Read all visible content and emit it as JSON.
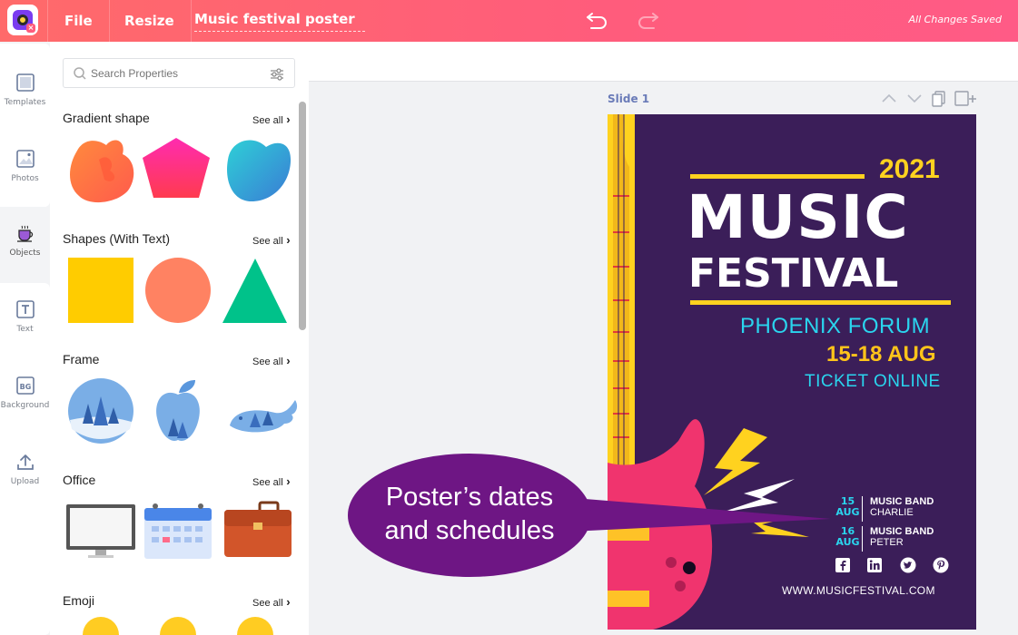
{
  "topbar": {
    "file_label": "File",
    "resize_label": "Resize",
    "doc_title": "Music festival poster",
    "saved_status": "All Changes Saved"
  },
  "rail": {
    "items": [
      {
        "label": "Templates",
        "icon": "templates-icon"
      },
      {
        "label": "Photos",
        "icon": "photos-icon"
      },
      {
        "label": "Objects",
        "icon": "objects-icon"
      },
      {
        "label": "Text",
        "icon": "text-icon"
      },
      {
        "label": "Background",
        "icon": "background-icon"
      },
      {
        "label": "Upload",
        "icon": "upload-icon"
      }
    ]
  },
  "panel": {
    "search_placeholder": "Search Properties",
    "see_all": "See all",
    "sections": [
      {
        "title": "Gradient shape"
      },
      {
        "title": "Shapes (With Text)"
      },
      {
        "title": "Frame"
      },
      {
        "title": "Office"
      },
      {
        "title": "Emoji"
      }
    ]
  },
  "canvas": {
    "slide_label": "Slide 1"
  },
  "poster": {
    "year": "2021",
    "title1": "MUSIC",
    "title2": "FESTIVAL",
    "venue": "PHOENIX FORUM",
    "dates": "15-18 AUG",
    "ticket": "TICKET ONLINE",
    "schedule": [
      {
        "day": "15",
        "month": "AUG",
        "band": "MUSIC BAND",
        "name": "CHARLIE"
      },
      {
        "day": "16",
        "month": "AUG",
        "band": "MUSIC BAND",
        "name": "PETER"
      }
    ],
    "url": "WWW.MUSICFESTIVAL.COM",
    "colors": {
      "background": "#3b1e59",
      "accent_yellow": "#ffd21f",
      "accent_cyan": "#2ad5ee",
      "guitar_pink": "#f0346e"
    }
  },
  "callout": {
    "line1": "Poster’s dates",
    "line2": "and schedules"
  }
}
